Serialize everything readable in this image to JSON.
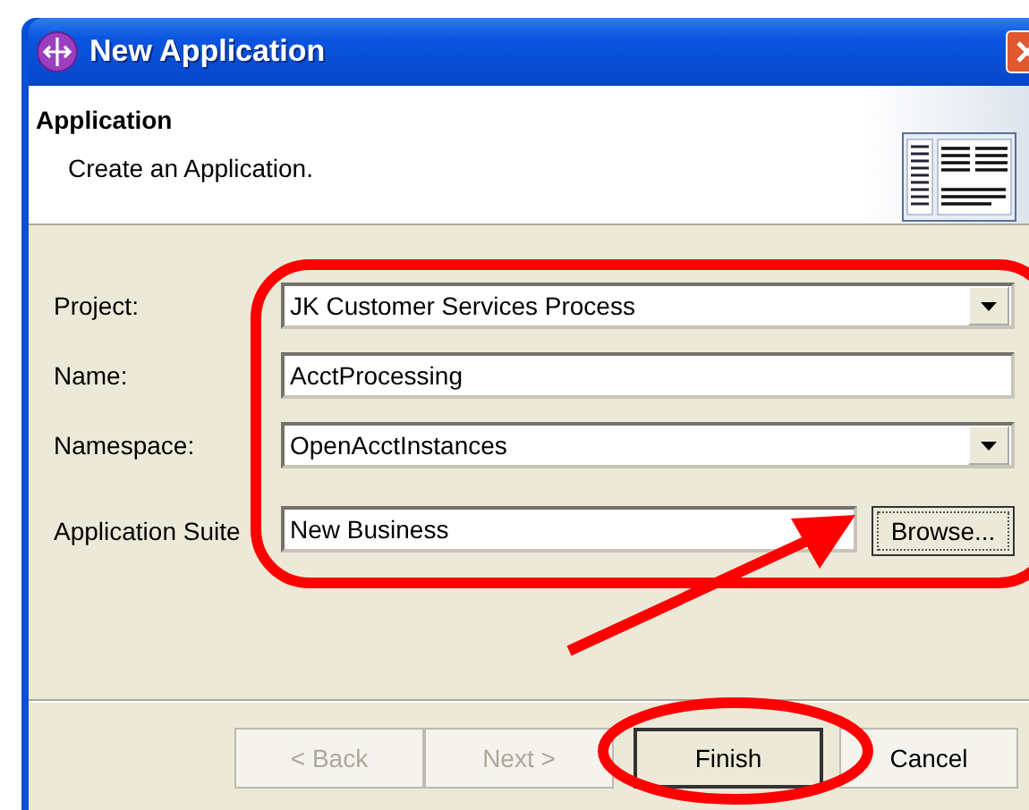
{
  "window": {
    "title": "New Application"
  },
  "header": {
    "title": "Application",
    "description": "Create an Application."
  },
  "fields": [
    {
      "kind": "dropdown",
      "label": "Project:",
      "value": "JK Customer Services Process"
    },
    {
      "kind": "text",
      "label": "Name:",
      "value": "AcctProcessing"
    },
    {
      "kind": "dropdown",
      "label": "Namespace:",
      "value": "OpenAcctInstances"
    },
    {
      "kind": "browse",
      "label": "Application Suite",
      "value": "New Business",
      "button": "Browse..."
    }
  ],
  "buttons": [
    {
      "label": "< Back",
      "disabled": true,
      "default": false
    },
    {
      "label": "Next >",
      "disabled": true,
      "default": false
    },
    {
      "label": "Finish",
      "disabled": false,
      "default": true
    },
    {
      "label": "Cancel",
      "disabled": false,
      "default": false
    }
  ]
}
